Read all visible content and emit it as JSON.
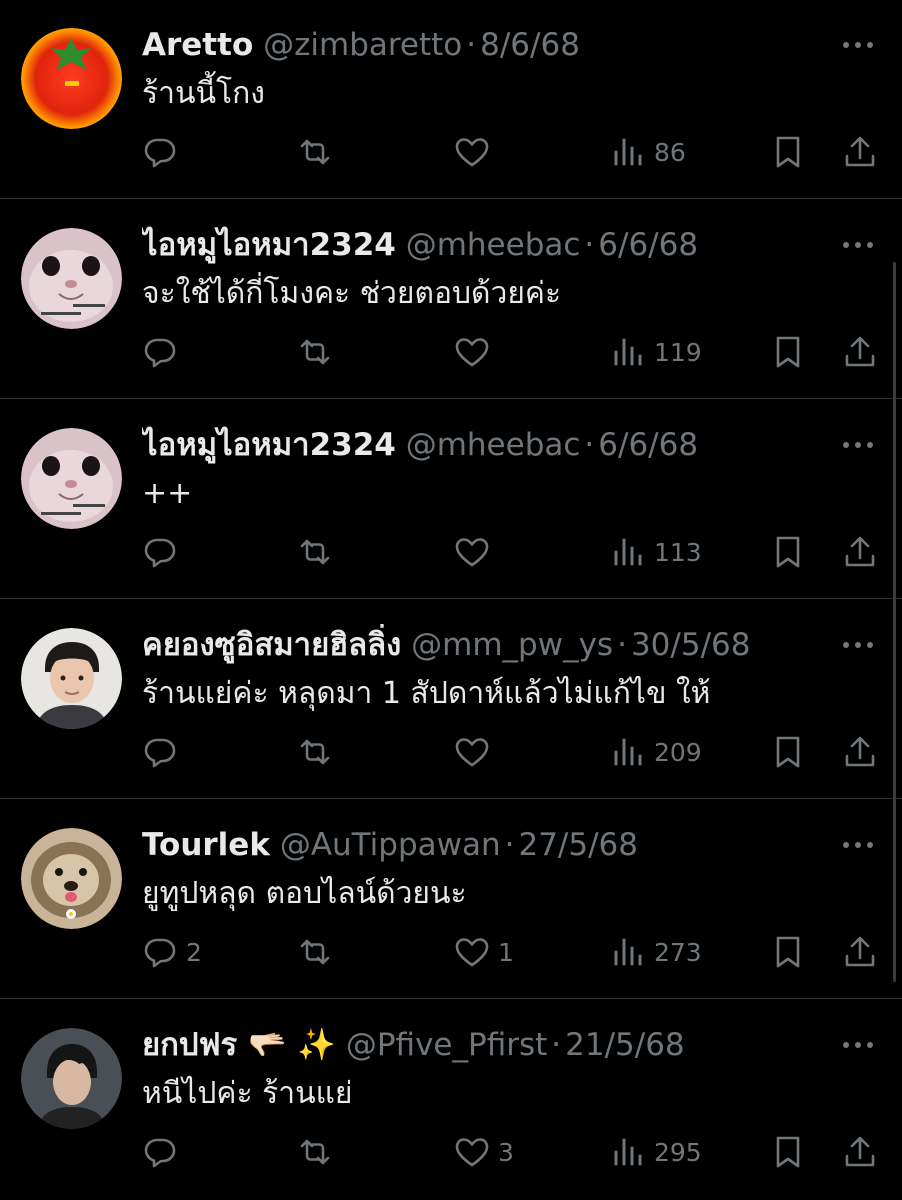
{
  "tweets": [
    {
      "name": "Aretto",
      "handle": "@zimbaretto",
      "date": "8/6/68",
      "text": "ร้านนี้โกง",
      "reply_count": "",
      "like_count": "",
      "views": "86",
      "avatar": "tomato-avatar"
    },
    {
      "name": "ไอหมูไอหมา2324",
      "handle": "@mheebac",
      "date": "6/6/68",
      "text": "จะใช้ได้กี่โมงคะ ช่วยตอบด้วยค่ะ",
      "reply_count": "",
      "like_count": "",
      "views": "119",
      "avatar": "cat-avatar"
    },
    {
      "name": "ไอหมูไอหมา2324",
      "handle": "@mheebac",
      "date": "6/6/68",
      "text": "++",
      "reply_count": "",
      "like_count": "",
      "views": "113",
      "avatar": "cat-avatar"
    },
    {
      "name": "คยองซูอิสมายฮิลลิ่ง",
      "handle": "@mm_pw_ys",
      "date": "30/5/68",
      "text": "ร้านแย่ค่ะ หลุดมา 1 สัปดาห์แล้วไม่แก้ไข ให้",
      "reply_count": "",
      "like_count": "",
      "views": "209",
      "avatar": "man-avatar"
    },
    {
      "name": "Tourlek",
      "handle": "@AuTippawan",
      "date": "27/5/68",
      "text": "ยูทูปหลุด ตอบไลน์ด้วยนะ",
      "reply_count": "2",
      "like_count": "1",
      "views": "273",
      "avatar": "dog-avatar"
    },
    {
      "name": "ยกปฟร 🫳🏻 ✨",
      "handle": "@Pfive_Pfirst",
      "date": "21/5/68",
      "text": "หนีไปค่ะ ร้านแย่",
      "reply_count": "",
      "like_count": "3",
      "views": "295",
      "avatar": "person-avatar"
    }
  ],
  "colors": {
    "background": "#000000",
    "text": "#e7e9ea",
    "muted": "#71767b",
    "divider": "#2f3336"
  }
}
